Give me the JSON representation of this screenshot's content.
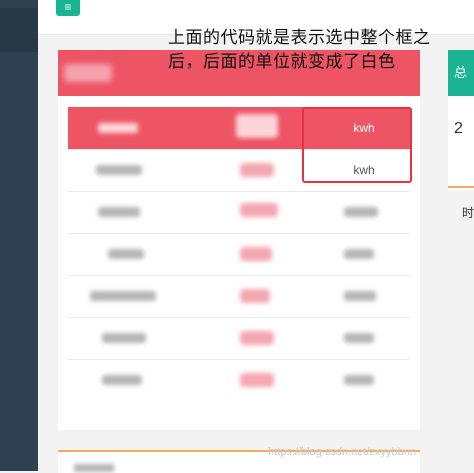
{
  "topbar": {
    "menu_icon": "≡"
  },
  "annotation": {
    "line1": "上面的代码就是表示选中整个框之",
    "line2": "后，后面的单位就变成了白色"
  },
  "table": {
    "rows": [
      {
        "unit": "kwh",
        "selected": true
      },
      {
        "unit": "kwh",
        "selected": false
      },
      {
        "unit": "",
        "selected": false
      },
      {
        "unit": "",
        "selected": false
      },
      {
        "unit": "",
        "selected": false
      },
      {
        "unit": "",
        "selected": false
      },
      {
        "unit": "",
        "selected": false
      }
    ]
  },
  "right_card": {
    "head_text": "总",
    "value": "2",
    "label": "时"
  },
  "watermark": "https://blog.csdn.net/zxyybbnn",
  "colors": {
    "selected_row": "#ed5565",
    "highlight_border": "#e8323c",
    "sidebar": "#2f4050",
    "accent": "#1ab394"
  }
}
